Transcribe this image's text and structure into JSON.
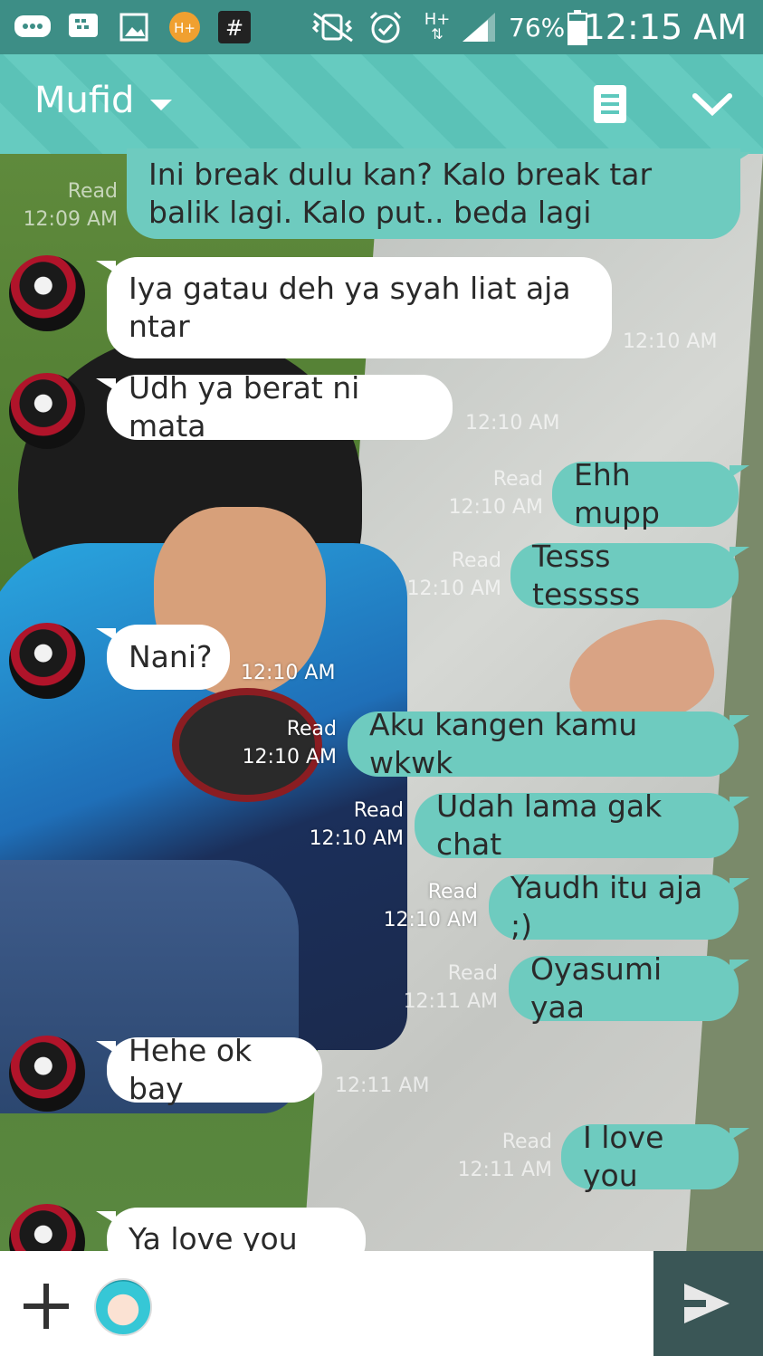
{
  "status_bar": {
    "battery": "76%",
    "time": "12:15 AM",
    "icons": [
      "chat-icon",
      "bbm-icon",
      "gallery-icon",
      "hplus-app-icon",
      "hash-app-icon",
      "vibrate-icon",
      "alarm-icon",
      "hplus-network-icon",
      "signal-icon",
      "battery-icon"
    ],
    "labels": {
      "hplus_app": "H+",
      "hash_app": "#",
      "network": "H+"
    }
  },
  "header": {
    "contact_name": "Mufid",
    "icons": [
      "dropdown-arrow-icon",
      "notes-icon",
      "check-icon"
    ]
  },
  "colors": {
    "header": "#5ec8bd",
    "status_bar": "#3d8e86",
    "outgoing_bubble": "#6ecbbf",
    "incoming_bubble": "#ffffff",
    "send_button": "#3a5656"
  },
  "messages": [
    {
      "dir": "out",
      "text": "Ini break dulu kan? Kalo break tar balik lagi. Kalo put.. beda lagi",
      "status": "Read",
      "time": "12:09 AM"
    },
    {
      "dir": "in",
      "text": "Iya gatau deh ya syah liat aja ntar",
      "time": "12:10 AM"
    },
    {
      "dir": "in",
      "text": "Udh ya berat ni mata",
      "time": "12:10 AM"
    },
    {
      "dir": "out",
      "text": "Ehh mupp",
      "status": "Read",
      "time": "12:10 AM"
    },
    {
      "dir": "out",
      "text": "Tesss tesssss",
      "status": "Read",
      "time": "12:10 AM"
    },
    {
      "dir": "in",
      "text": "Nani?",
      "time": "12:10 AM"
    },
    {
      "dir": "out",
      "text": "Aku kangen kamu wkwk",
      "status": "Read",
      "time": "12:10 AM"
    },
    {
      "dir": "out",
      "text": "Udah lama gak chat",
      "status": "Read",
      "time": "12:10 AM"
    },
    {
      "dir": "out",
      "text": "Yaudh itu aja ;)",
      "status": "Read",
      "time": "12:10 AM"
    },
    {
      "dir": "out",
      "text": "Oyasumi yaa",
      "status": "Read",
      "time": "12:11 AM"
    },
    {
      "dir": "in",
      "text": "Hehe ok bay",
      "time": "12:11 AM"
    },
    {
      "dir": "out",
      "text": "I love you",
      "status": "Read",
      "time": "12:11 AM"
    },
    {
      "dir": "in",
      "text": "Ya love you too",
      "time": ""
    }
  ],
  "composer": {
    "icons": [
      "plus-icon",
      "sticker-icon",
      "send-icon"
    ]
  }
}
